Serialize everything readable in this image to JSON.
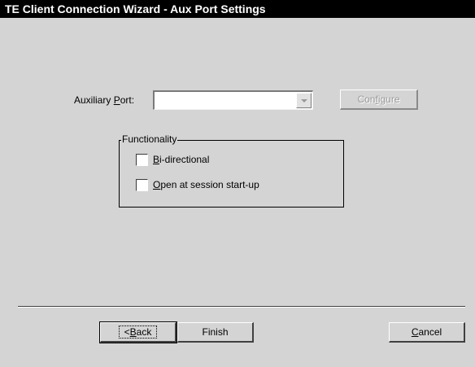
{
  "window": {
    "title": "TE Client Connection Wizard - Aux Port Settings"
  },
  "aux_port": {
    "label_pre": "Auxiliary ",
    "label_key": "P",
    "label_post": "ort:",
    "selected_value": ""
  },
  "configure_button": {
    "label_pre": "Con",
    "label_key": "f",
    "label_post": "igure",
    "enabled": false
  },
  "functionality": {
    "legend": "Functionality",
    "options": [
      {
        "key": "B",
        "rest": "i-directional",
        "checked": false
      },
      {
        "key": "O",
        "rest": "pen at session start-up",
        "checked": false
      }
    ]
  },
  "footer": {
    "back": {
      "pre": "<",
      "key": "B",
      "post": "ack"
    },
    "finish": {
      "label": "Finish"
    },
    "cancel": {
      "key": "C",
      "post": "ancel"
    }
  },
  "colors": {
    "titlebar_bg": "#000000",
    "titlebar_text": "#ffffff",
    "dialog_bg": "#d4d4d4"
  }
}
